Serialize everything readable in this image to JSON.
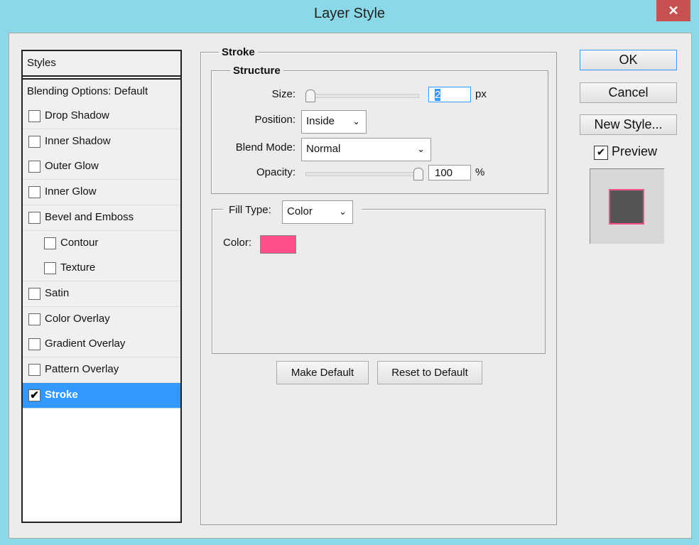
{
  "window": {
    "title": "Layer Style",
    "close": "✕"
  },
  "styles_panel": {
    "header": "Styles",
    "blending": "Blending Options: Default",
    "items": [
      {
        "label": "Drop Shadow",
        "checked": false,
        "indent": false
      },
      {
        "label": "Inner Shadow",
        "checked": false,
        "indent": false
      },
      {
        "label": "Outer Glow",
        "checked": false,
        "indent": false
      },
      {
        "label": "Inner Glow",
        "checked": false,
        "indent": false
      },
      {
        "label": "Bevel and Emboss",
        "checked": false,
        "indent": false
      },
      {
        "label": "Contour",
        "checked": false,
        "indent": true
      },
      {
        "label": "Texture",
        "checked": false,
        "indent": true
      },
      {
        "label": "Satin",
        "checked": false,
        "indent": false
      },
      {
        "label": "Color Overlay",
        "checked": false,
        "indent": false
      },
      {
        "label": "Gradient Overlay",
        "checked": false,
        "indent": false
      },
      {
        "label": "Pattern Overlay",
        "checked": false,
        "indent": false
      },
      {
        "label": "Stroke",
        "checked": true,
        "indent": false
      }
    ]
  },
  "stroke": {
    "title": "Stroke",
    "structure": "Structure",
    "size_label": "Size:",
    "size_value": "2",
    "size_unit": "px",
    "size_fraction": 0.0,
    "position_label": "Position:",
    "position_value": "Inside",
    "blend_label": "Blend Mode:",
    "blend_value": "Normal",
    "opacity_label": "Opacity:",
    "opacity_value": "100",
    "opacity_unit": "%",
    "opacity_fraction": 1.0,
    "fill_type_label": "Fill Type:",
    "fill_type_value": "Color",
    "color_label": "Color:",
    "color": "#ff4f8b",
    "make_default": "Make Default",
    "reset_default": "Reset to Default"
  },
  "buttons": {
    "ok": "OK",
    "cancel": "Cancel",
    "new_style": "New Style...",
    "preview": "Preview",
    "preview_checked": true
  },
  "colors": {
    "accent": "#3399ff",
    "titlebar": "#8bd8e8",
    "preview_fill": "#555555"
  }
}
